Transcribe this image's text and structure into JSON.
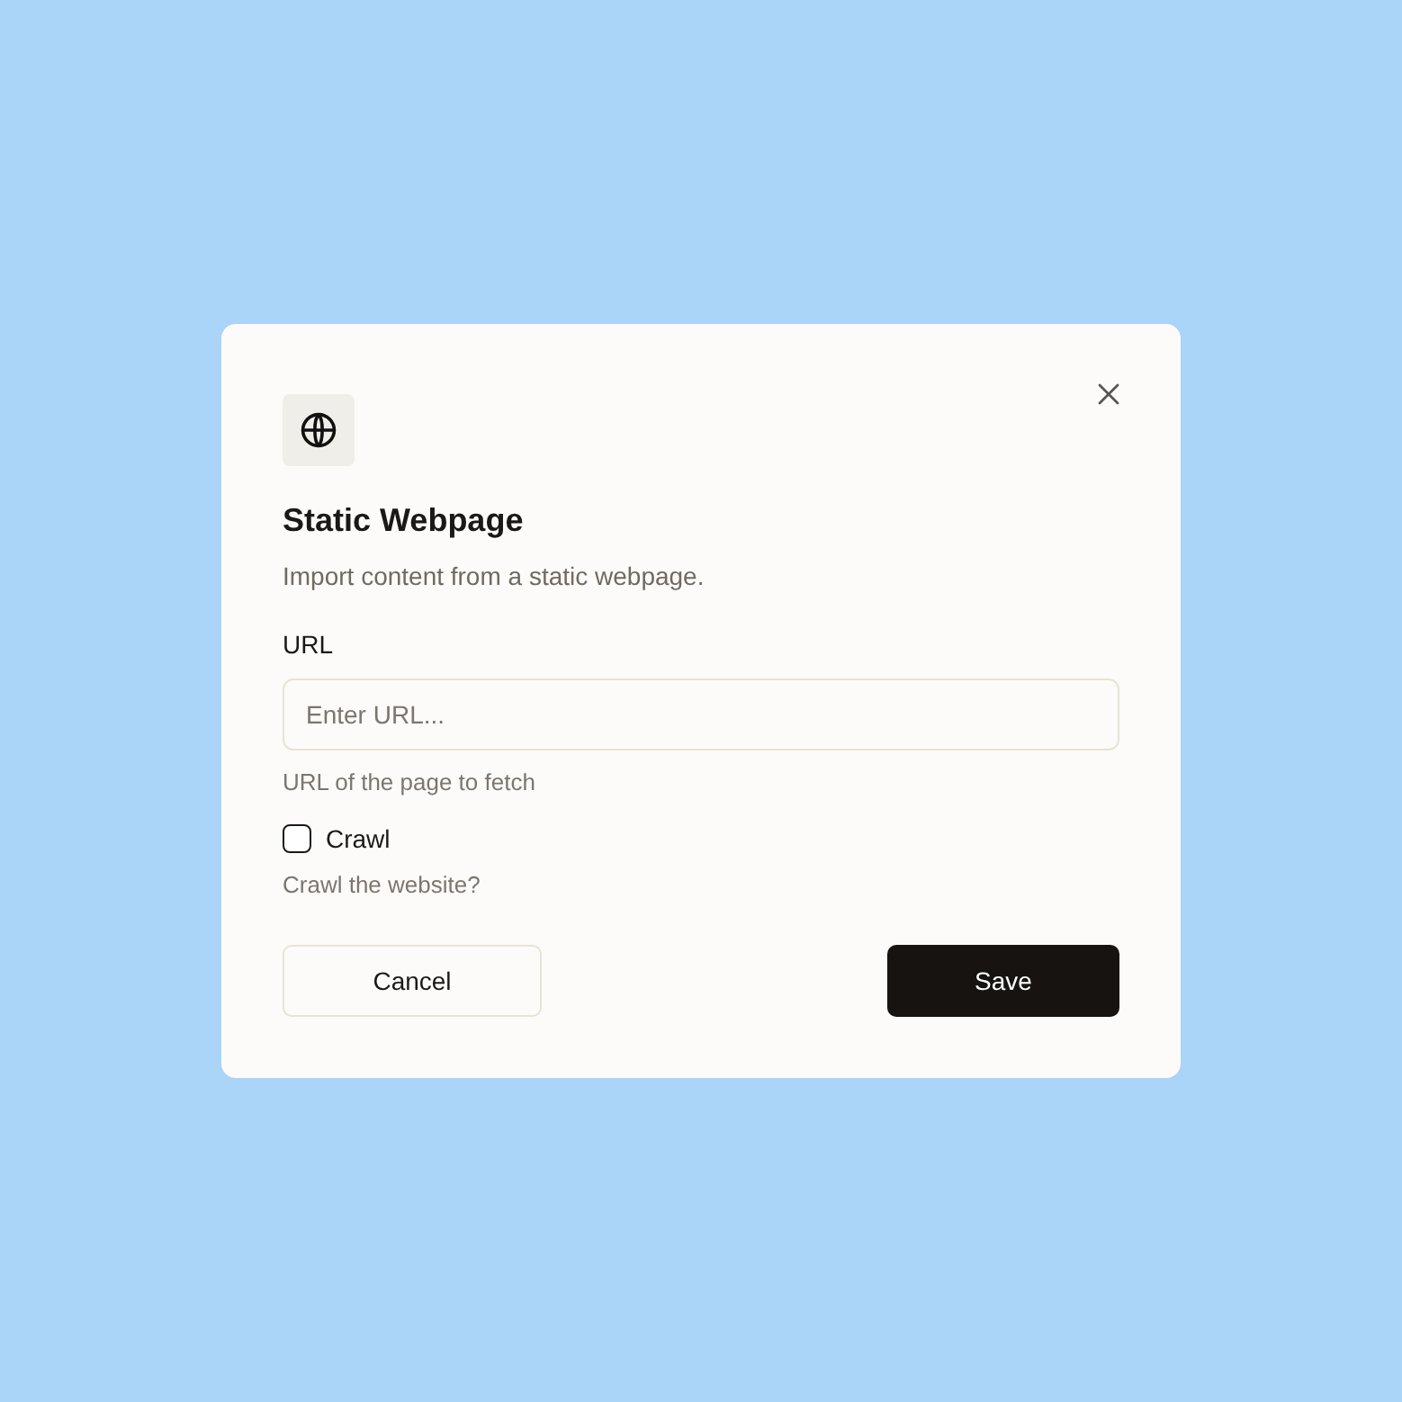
{
  "dialog": {
    "title": "Static Webpage",
    "description": "Import content from a static webpage.",
    "url_field": {
      "label": "URL",
      "placeholder": "Enter URL...",
      "hint": "URL of the page to fetch"
    },
    "crawl": {
      "label": "Crawl",
      "checked": false,
      "hint": "Crawl the website?"
    },
    "buttons": [
      {
        "label": "Cancel",
        "kind": "secondary"
      },
      {
        "label": "Save",
        "kind": "primary"
      }
    ]
  }
}
